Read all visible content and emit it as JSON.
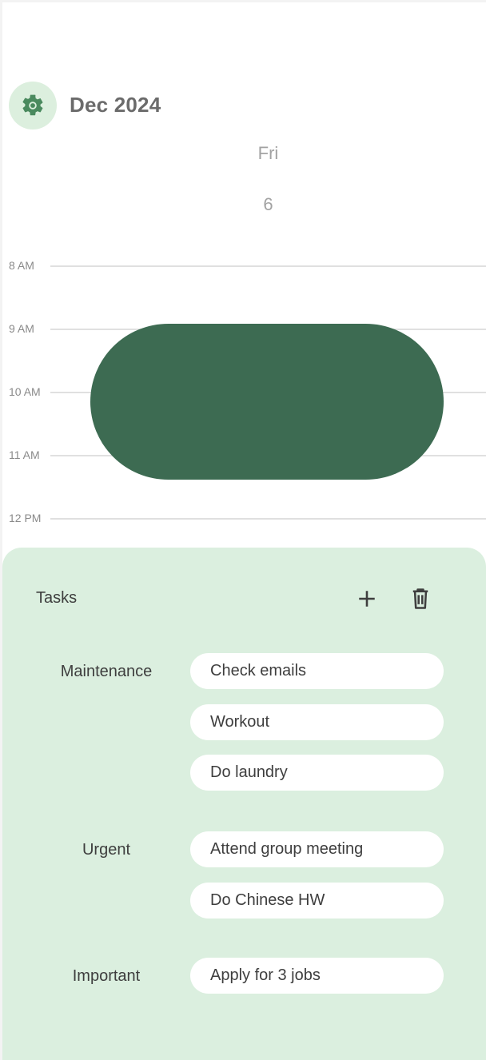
{
  "header": {
    "settings_icon": "gear-icon",
    "month_title": "Dec 2024",
    "day_name": "Fri",
    "day_number": "6"
  },
  "calendar": {
    "hours": [
      "8 AM",
      "9 AM",
      "10 AM",
      "11 AM",
      "12 PM"
    ],
    "event": {
      "color": "#3d6b52"
    }
  },
  "tasks": {
    "title": "Tasks",
    "add_icon": "plus-icon",
    "delete_icon": "trash-icon",
    "categories": [
      {
        "label": "Maintenance",
        "items": [
          "Check emails",
          "Workout",
          "Do laundry"
        ]
      },
      {
        "label": "Urgent",
        "items": [
          "Attend group meeting",
          "Do Chinese HW"
        ]
      },
      {
        "label": "Important",
        "items": [
          "Apply for 3 jobs"
        ]
      }
    ]
  },
  "colors": {
    "panel_bg": "#dbefdf",
    "accent": "#3d6b52",
    "icon_green": "#4a8a5e"
  }
}
